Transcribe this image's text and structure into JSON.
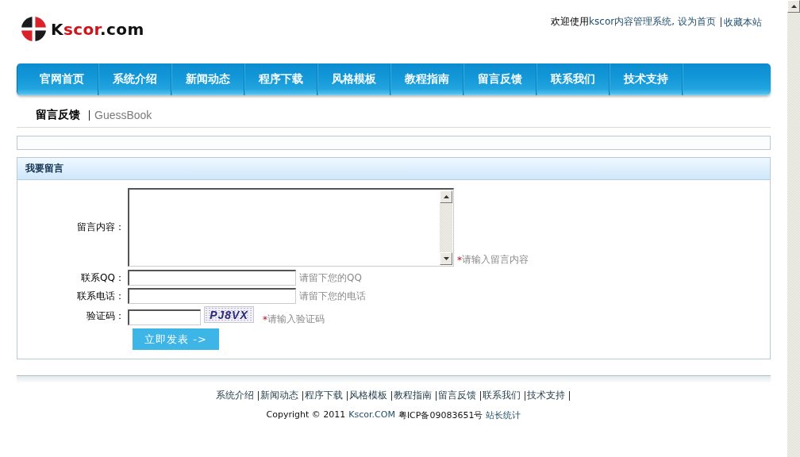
{
  "logo": {
    "text": "K**scor**.com"
  },
  "top_bar": {
    "greeting": "欢迎使用",
    "links": [
      {
        "label": "kscor内容管理系统,",
        "divider_before": false
      },
      {
        "label": "设为首页",
        "divider_before": false
      },
      {
        "label": "收藏本站",
        "divider_before": true
      }
    ]
  },
  "nav": {
    "items": [
      {
        "label": "官网首页"
      },
      {
        "label": "系统介绍"
      },
      {
        "label": "新闻动态"
      },
      {
        "label": "程序下载"
      },
      {
        "label": "风格模板"
      },
      {
        "label": "教程指南"
      },
      {
        "label": "留言反馈"
      },
      {
        "label": "联系我们"
      },
      {
        "label": "技术支持"
      }
    ]
  },
  "breadcrumb": {
    "title": "留言反馈",
    "subtitle": "GuessBook"
  },
  "form": {
    "title": "我要留言",
    "fields": [
      {
        "kind": "textarea",
        "label": "留言内容：",
        "required_mark": "*",
        "hint": "请输入留言内容"
      },
      {
        "kind": "text",
        "label": "联系QQ：",
        "hint": "请留下您的QQ"
      },
      {
        "kind": "text",
        "label": "联系电话：",
        "hint": "请留下您的电话"
      },
      {
        "kind": "captcha",
        "label": "验证码：",
        "captcha": "PJ8VX",
        "required_mark": "*",
        "hint": "请输入验证码"
      }
    ],
    "submit": "立即发表 ->"
  },
  "footer": {
    "links": [
      {
        "label": "系统介绍"
      },
      {
        "label": "新闻动态"
      },
      {
        "label": "程序下载"
      },
      {
        "label": "风格模板"
      },
      {
        "label": "教程指南"
      },
      {
        "label": "留言反馈"
      },
      {
        "label": "联系我们"
      },
      {
        "label": "技术支持"
      }
    ],
    "copyright": "Copyright © 2011",
    "site_link": "Kscor.COM",
    "icp": "粤ICP备09083651号",
    "stats_link": "站长统计"
  }
}
